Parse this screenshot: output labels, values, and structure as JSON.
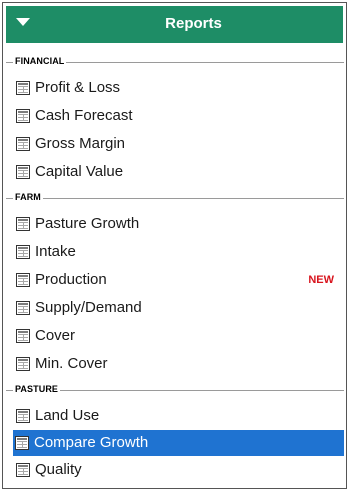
{
  "header": {
    "title": "Reports"
  },
  "groups": {
    "financial": {
      "label": "FINANCIAL",
      "items": [
        "Profit & Loss",
        "Cash Forecast",
        "Gross Margin",
        "Capital Value"
      ]
    },
    "farm": {
      "label": "FARM",
      "items": [
        "Pasture Growth",
        "Intake",
        "Production",
        "Supply/Demand",
        "Cover",
        "Min. Cover"
      ],
      "production_badge": "NEW"
    },
    "pasture": {
      "label": "PASTURE",
      "items": [
        "Land Use",
        "Compare Growth",
        "Quality"
      ],
      "selected_item": "Compare Growth"
    }
  },
  "colors": {
    "header_bg": "#1e8d66",
    "selected_bg": "#1f73d1",
    "new_badge": "#d8141d"
  },
  "icons": {
    "collapse": "chevron-down-icon",
    "report": "report-table-icon"
  }
}
